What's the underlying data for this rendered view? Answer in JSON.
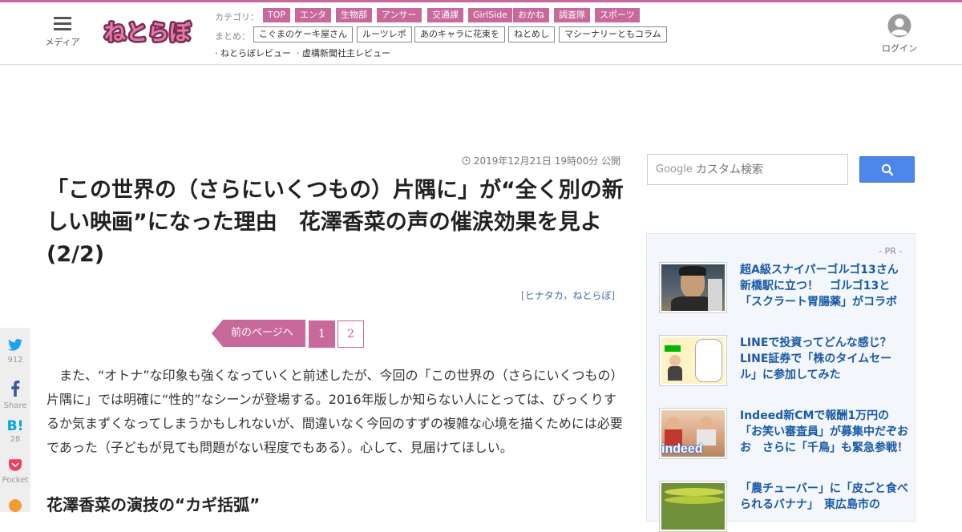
{
  "header": {
    "menu_label": "メディア",
    "logo_text": "ねとらぼ",
    "category_label": "カテゴリ：",
    "categories": [
      "TOP",
      "エンタ",
      "生物部",
      "アンサー",
      "交通課",
      "GirlSide",
      "おかね",
      "調査隊",
      "スポーツ"
    ],
    "summary_label": "まとめ：",
    "summaries": [
      "こぐまのケーキ屋さん",
      "ルーツレポ",
      "あのキャラに花束を",
      "ねとめし",
      "マシーナリーともコラム"
    ],
    "reviews": [
      "· ねとらぼレビュー",
      "· 虚構新聞社主レビュー"
    ],
    "login_label": "ログイン",
    "accent_color": "#c9689a"
  },
  "article": {
    "date": "2019年12月21日 19時00分 公開",
    "title": "「この世界の（さらにいくつもの）片隅に」が“全く別の新しい映画”になった理由　花澤香菜の声の催涙効果を見よ (2/2)",
    "byline_open": "[",
    "author": "ヒナタカ",
    "byline_sep": "，",
    "publisher": "ねとらぼ",
    "byline_close": "]",
    "prev_page_label": "前のページへ",
    "pages": [
      "1",
      "2"
    ],
    "current_page": "1",
    "body": "また、“オトナ”な印象も強くなっていくと前述したが、今回の「この世界の（さらにいくつもの）片隅に」では明確に“性的”なシーンが登場する。2016年版しか知らない人にとっては、びっくりするか気まずくなってしまうかもしれないが、間違いなく今回のすずの複雑な心境を描くためには必要であった（子どもが見ても問題がない程度でもある）。心して、見届けてほしい。",
    "subheading": "花澤香菜の演技の“カギ括弧”"
  },
  "share": {
    "twitter_count": "912",
    "facebook_label": "Share",
    "hatena_label": "B!",
    "hatena_count": "28",
    "pocket_label": "Pocket"
  },
  "sidebar": {
    "search_brand": "Google",
    "search_placeholder": "カスタム検索",
    "pr_label": "- PR -",
    "ads": [
      {
        "title": "超A級スナイパーゴルゴ13さん新橋駅に立つ！　ゴルゴ13と「スクラート胃腸薬」がコラボ",
        "thumb_icon": "golgo-figure-thumb"
      },
      {
        "title": "LINEで投資ってどんな感じ？ LINE証券で「株のタイムセール」に参加してみた",
        "thumb_icon": "line-comic-thumb"
      },
      {
        "title": "Indeed新CMで報酬1万円の「お笑い審査員」が募集中だぞおお　さらに「千鳥」も緊急参戦！",
        "thumb_icon": "indeed-thumb",
        "thumb_text": "indeed"
      },
      {
        "title": "「農チューバー」に「皮ごと食べられるバナナ」　東広島市の",
        "thumb_icon": "banana-thumb"
      }
    ]
  }
}
